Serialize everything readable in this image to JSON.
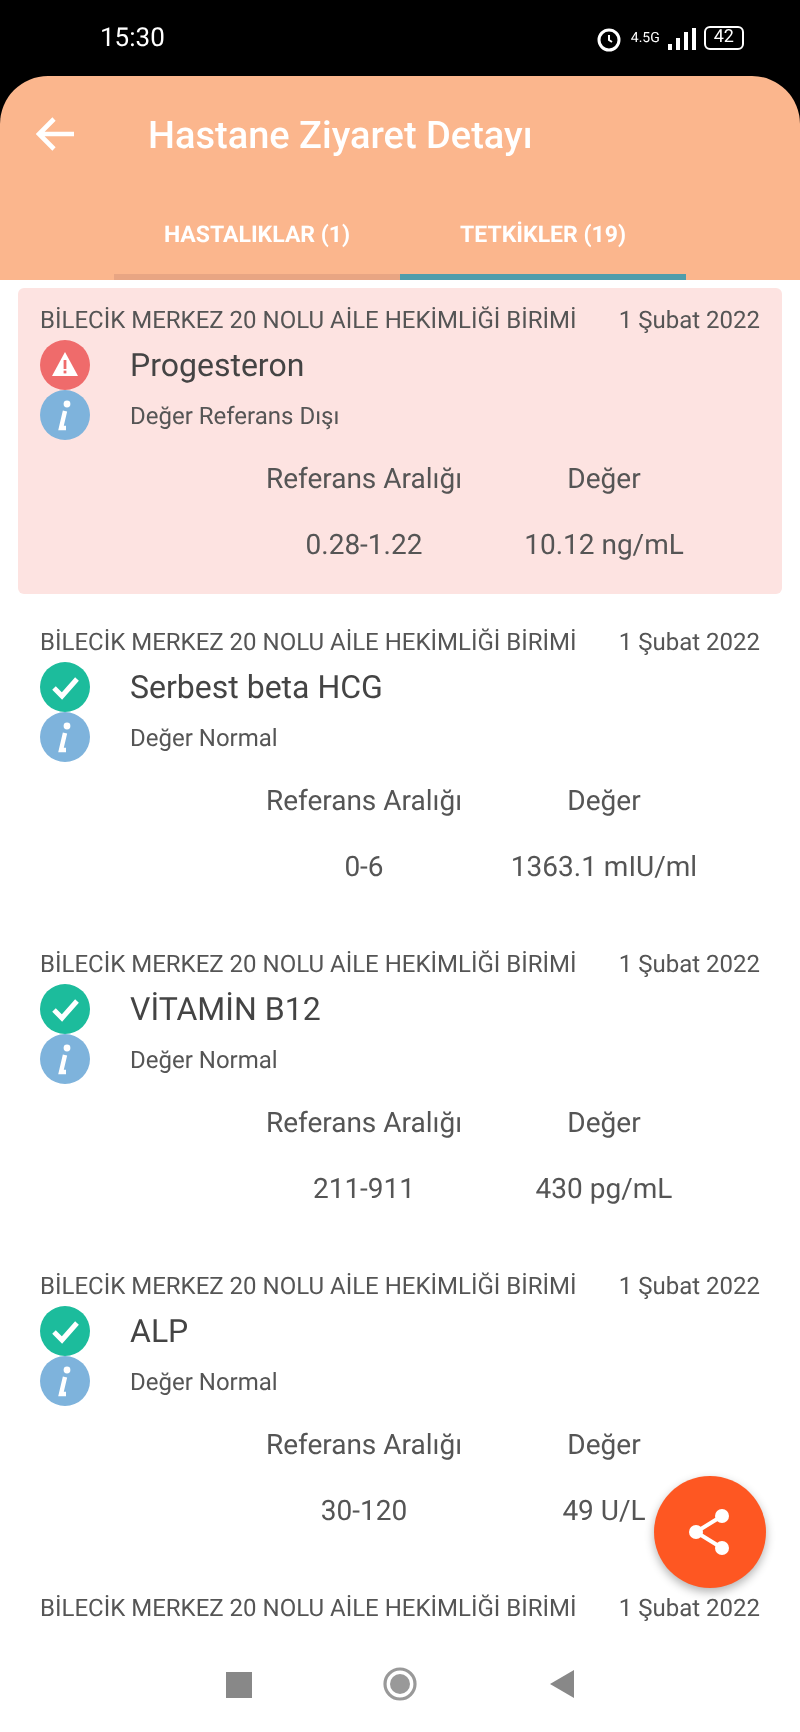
{
  "status_bar": {
    "time": "15:30",
    "battery": "42",
    "network": "4.5G"
  },
  "header": {
    "title": "Hastane Ziyaret Detayı"
  },
  "tabs": [
    {
      "label": "HASTALIKLAR (1)",
      "selected": false
    },
    {
      "label": "TETKİKLER (19)",
      "selected": true
    }
  ],
  "results": [
    {
      "kind": "abnormal",
      "facility": "BİLECİK MERKEZ 20 NOLU AİLE HEKİMLİĞİ BİRİMİ",
      "date": "1 Şubat 2022",
      "test": "Progesteron",
      "status": "Değer Referans Dışı",
      "range_label": "Referans Aralığı",
      "value_label": "Değer",
      "range": "0.28-1.22",
      "value": "10.12 ng/mL"
    },
    {
      "kind": "normal",
      "facility": "BİLECİK MERKEZ 20 NOLU AİLE HEKİMLİĞİ BİRİMİ",
      "date": "1 Şubat 2022",
      "test": "Serbest beta HCG",
      "status": "Değer Normal",
      "range_label": "Referans Aralığı",
      "value_label": "Değer",
      "range": "0-6",
      "value": "1363.1 mIU/ml"
    },
    {
      "kind": "normal",
      "facility": "BİLECİK MERKEZ 20 NOLU AİLE HEKİMLİĞİ BİRİMİ",
      "date": "1 Şubat 2022",
      "test": "VİTAMİN B12",
      "status": "Değer Normal",
      "range_label": "Referans Aralığı",
      "value_label": "Değer",
      "range": "211-911",
      "value": "430 pg/mL"
    },
    {
      "kind": "normal",
      "facility": "BİLECİK MERKEZ 20 NOLU AİLE HEKİMLİĞİ BİRİMİ",
      "date": "1 Şubat 2022",
      "test": "ALP",
      "status": "Değer Normal",
      "range_label": "Referans Aralığı",
      "value_label": "Değer",
      "range": "30-120",
      "value": "49 U/L"
    },
    {
      "kind": "normal",
      "facility": "BİLECİK MERKEZ 20 NOLU AİLE HEKİMLİĞİ BİRİMİ",
      "date": "1 Şubat 2022"
    }
  ]
}
